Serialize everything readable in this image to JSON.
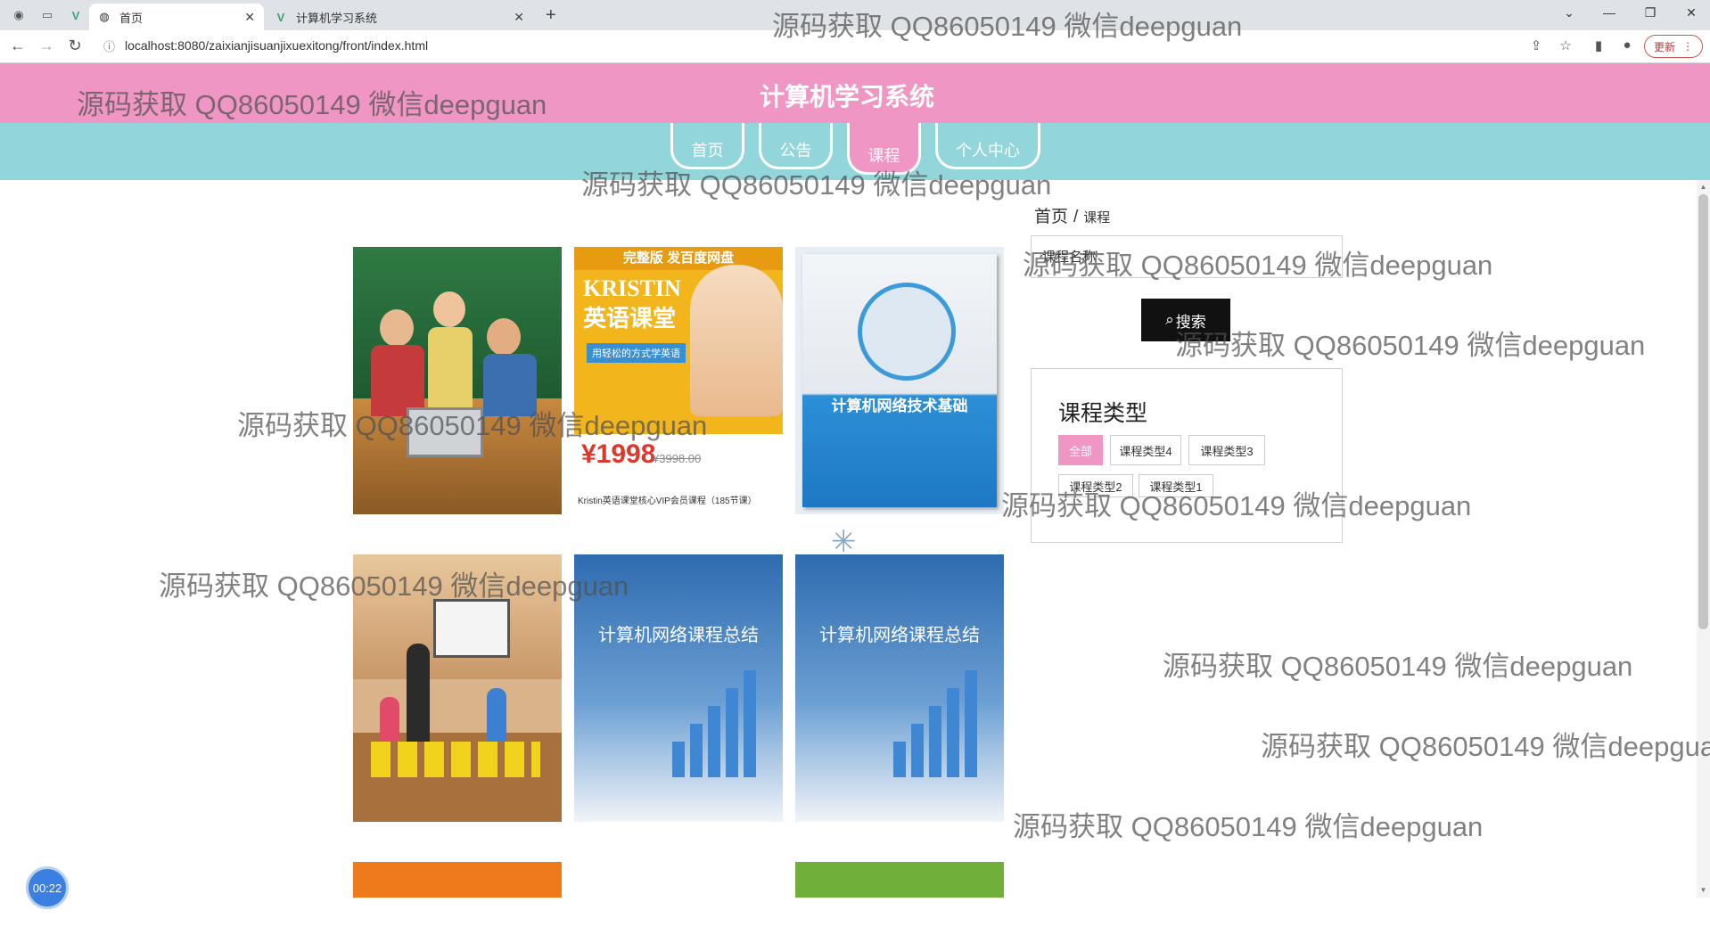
{
  "browser": {
    "tabs": [
      {
        "title": "首页",
        "icon": "globe-icon",
        "active": true
      },
      {
        "title": "计算机学习系统",
        "icon": "vue-logo-icon",
        "active": false
      }
    ],
    "url": "localhost:8080/zaixianjisuanjixuexitong/front/index.html",
    "update_label": "更新"
  },
  "site": {
    "title": "计算机学习系统",
    "nav": [
      "首页",
      "公告",
      "课程",
      "个人中心"
    ],
    "active_nav": "课程"
  },
  "breadcrumb": {
    "home": "首页",
    "separator": "/",
    "current": "课程"
  },
  "search": {
    "placeholder": "课程名称",
    "button_label": "搜索"
  },
  "course_types": {
    "title": "课程类型",
    "items": [
      "全部",
      "课程类型4",
      "课程类型3",
      "课程类型2",
      "课程类型1"
    ],
    "active": "全部"
  },
  "courses": [
    {
      "image": "children-classroom-photo"
    },
    {
      "image": "kristin-english-course-poster",
      "poster_title": "KRISTIN 英语课堂",
      "banner": "完整版 发百度网盘",
      "subtitle": "用轻松的方式学英语",
      "price": "¥1998",
      "old_price": "¥3998.00",
      "caption": "Kristin英语课堂核心VIP会员课程（185节课）"
    },
    {
      "image": "network-textbook-cover",
      "book_title": "计算机网络技术基础"
    },
    {
      "image": "kids-classroom-photo"
    },
    {
      "image": "network-course-summary-slide",
      "slide_title": "计算机网络课程总结"
    },
    {
      "image": "network-course-summary-slide",
      "slide_title": "计算机网络课程总结"
    },
    {
      "image": "orange-course-banner"
    },
    {
      "image": "english-course-banner"
    }
  ],
  "timer": "00:22",
  "watermark": "源码获取 QQ86050149 微信deepguan",
  "colors": {
    "header_pink": "#f096c4",
    "nav_teal": "#92d6dc",
    "search_button": "#111111"
  }
}
